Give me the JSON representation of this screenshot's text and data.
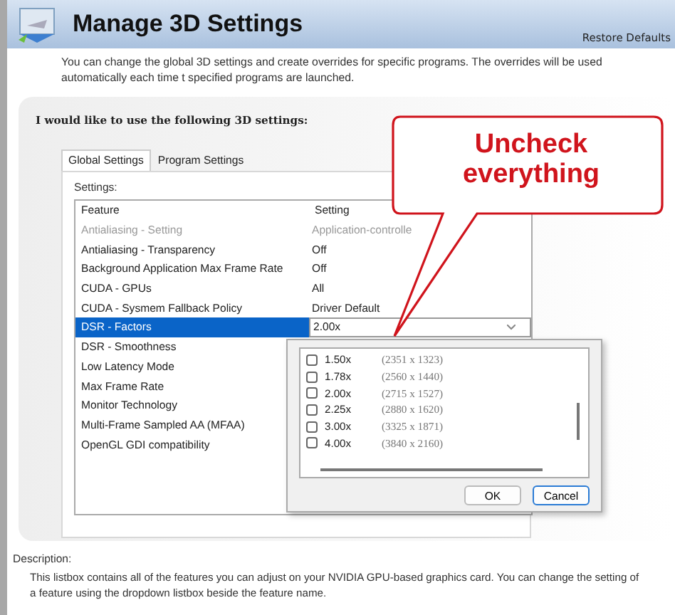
{
  "header": {
    "title": "Manage 3D Settings",
    "restore_link": "Restore Defaults"
  },
  "intro": "You can change the global 3D settings and create overrides for specific programs. The overrides will be used automatically each time t specified programs are launched.",
  "panel": {
    "heading": "I would like to use the following 3D settings:",
    "tabs": [
      {
        "label": "Global Settings",
        "selected": true
      },
      {
        "label": "Program Settings",
        "selected": false
      }
    ],
    "settings_label": "Settings:",
    "table": {
      "columns": [
        "Feature",
        "Setting"
      ],
      "rows": [
        {
          "feature": "Antialiasing - Setting",
          "setting": "Application-controlle",
          "disabled": true,
          "selected": false
        },
        {
          "feature": "Antialiasing - Transparency",
          "setting": "Off",
          "disabled": false,
          "selected": false
        },
        {
          "feature": "Background Application Max Frame Rate",
          "setting": "Off",
          "disabled": false,
          "selected": false
        },
        {
          "feature": "CUDA - GPUs",
          "setting": "All",
          "disabled": false,
          "selected": false
        },
        {
          "feature": "CUDA - Sysmem Fallback Policy",
          "setting": "Driver Default",
          "disabled": false,
          "selected": false
        },
        {
          "feature": "DSR - Factors",
          "setting": "2.00x",
          "disabled": false,
          "selected": true
        },
        {
          "feature": "DSR - Smoothness",
          "disabled": false,
          "selected": false
        },
        {
          "feature": "Low Latency Mode",
          "disabled": false,
          "selected": false
        },
        {
          "feature": "Max Frame Rate",
          "disabled": false,
          "selected": false
        },
        {
          "feature": "Monitor Technology",
          "disabled": false,
          "selected": false
        },
        {
          "feature": "Multi-Frame Sampled AA (MFAA)",
          "disabled": false,
          "selected": false
        },
        {
          "feature": "OpenGL GDI compatibility",
          "disabled": false,
          "selected": false
        }
      ]
    },
    "dropdown": {
      "options": [
        {
          "label": "1.50x",
          "resolution": "(2351 x 1323)",
          "checked": false
        },
        {
          "label": "1.78x",
          "resolution": "(2560 x 1440)",
          "checked": false
        },
        {
          "label": "2.00x",
          "resolution": "(2715 x 1527)",
          "checked": false
        },
        {
          "label": "2.25x",
          "resolution": "(2880 x 1620)",
          "checked": false
        },
        {
          "label": "3.00x",
          "resolution": "(3325 x 1871)",
          "checked": false
        },
        {
          "label": "4.00x",
          "resolution": "(3840 x 2160)",
          "checked": false
        }
      ],
      "buttons": [
        "OK",
        "Cancel"
      ]
    }
  },
  "callout": "Uncheck everything",
  "description": {
    "label": "Description:",
    "text": "This listbox contains all of the features you can adjust on your NVIDIA GPU-based graphics card. You can change the setting of a feature using the dropdown listbox beside the feature name."
  }
}
